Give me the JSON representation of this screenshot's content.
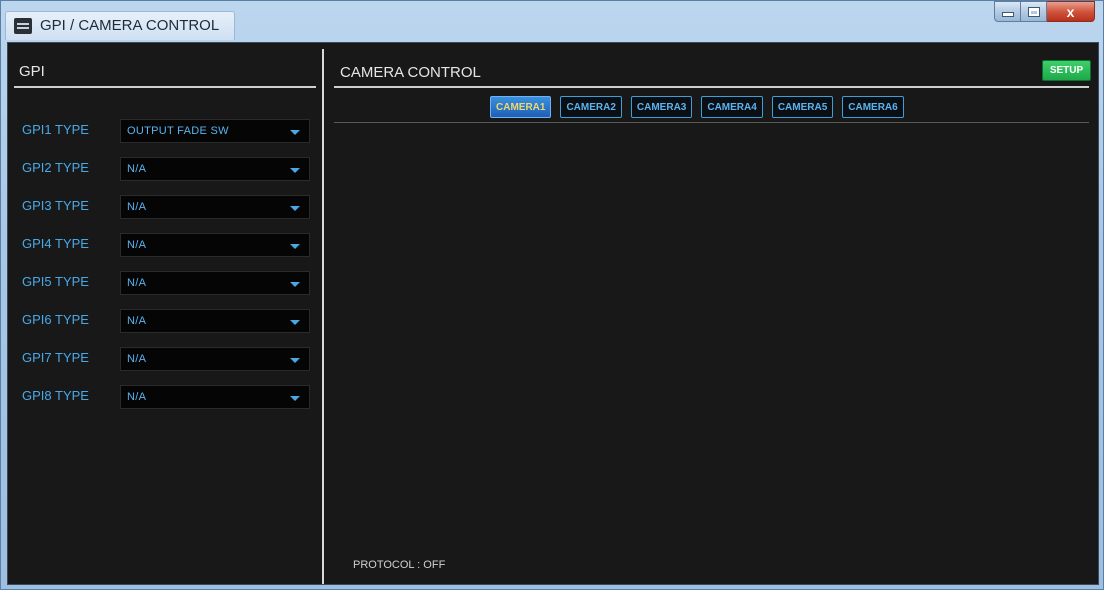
{
  "window": {
    "title": "GPI / CAMERA CONTROL",
    "close_label": "x"
  },
  "gpi": {
    "title": "GPI",
    "rows": [
      {
        "label": "GPI1 TYPE",
        "value": "OUTPUT FADE SW"
      },
      {
        "label": "GPI2 TYPE",
        "value": "N/A"
      },
      {
        "label": "GPI3 TYPE",
        "value": "N/A"
      },
      {
        "label": "GPI4 TYPE",
        "value": "N/A"
      },
      {
        "label": "GPI5 TYPE",
        "value": "N/A"
      },
      {
        "label": "GPI6 TYPE",
        "value": "N/A"
      },
      {
        "label": "GPI7 TYPE",
        "value": "N/A"
      },
      {
        "label": "GPI8 TYPE",
        "value": "N/A"
      }
    ]
  },
  "camera": {
    "title": "CAMERA CONTROL",
    "setup_label": "SETUP",
    "tabs": [
      "CAMERA1",
      "CAMERA2",
      "CAMERA3",
      "CAMERA4",
      "CAMERA5",
      "CAMERA6"
    ],
    "active_tab": "CAMERA1",
    "protocol": "PROTOCOL : OFF"
  },
  "colors": {
    "accent": "#4aa8e8",
    "setup": "#1ea84a",
    "active_tab_text": "#f0d870",
    "background": "#181818"
  }
}
